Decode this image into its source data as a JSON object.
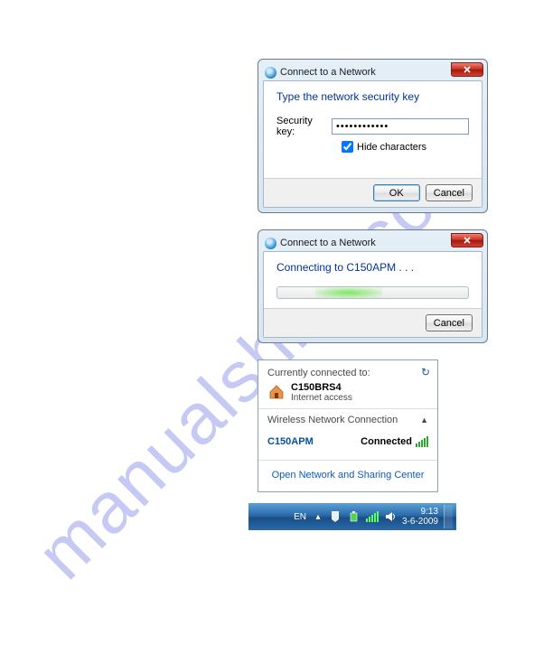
{
  "watermark": "manualshive.com",
  "dialog1": {
    "title": "Connect to a Network",
    "heading": "Type the network security key",
    "field_label": "Security key:",
    "field_value": "••••••••••••",
    "hide_chars_label": "Hide characters",
    "hide_chars_checked": true,
    "ok_label": "OK",
    "cancel_label": "Cancel"
  },
  "dialog2": {
    "title": "Connect to a Network",
    "heading": "Connecting to C150APM . . .",
    "cancel_label": "Cancel"
  },
  "flyout": {
    "currently_label": "Currently connected to:",
    "net_name": "C150BRS4",
    "net_sub": "Internet access",
    "section_label": "Wireless Network Connection",
    "item_ssid": "C150APM",
    "item_status": "Connected",
    "link_label": "Open Network and Sharing Center"
  },
  "taskbar": {
    "lang": "EN",
    "time": "9:13",
    "date": "3-6-2009"
  }
}
